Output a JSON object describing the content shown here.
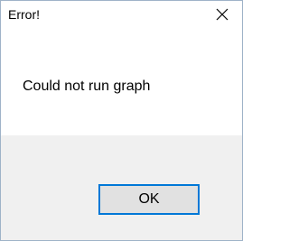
{
  "window": {
    "title": "Error!",
    "close_icon": "close-icon"
  },
  "body": {
    "message": "Could not run graph"
  },
  "footer": {
    "ok_label": "OK"
  },
  "colors": {
    "accent": "#0078d7",
    "footer_bg": "#f0f0f0",
    "button_bg": "#e1e1e1",
    "window_border": "#9fb3c8"
  }
}
